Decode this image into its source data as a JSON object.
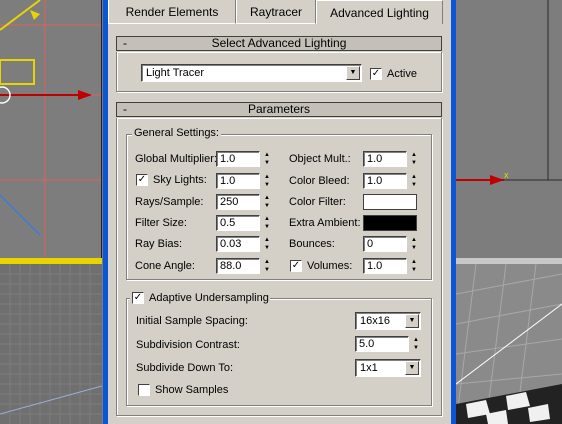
{
  "tabs": [
    {
      "label": "Render Elements"
    },
    {
      "label": "Raytracer"
    },
    {
      "label": "Advanced Lighting"
    }
  ],
  "select_rollout": {
    "title": "Select Advanced Lighting",
    "toggle": "-",
    "plugin": "Light Tracer",
    "active_label": "Active",
    "active_checked": true
  },
  "params_rollout": {
    "title": "Parameters",
    "toggle": "-"
  },
  "general": {
    "title": "General Settings:",
    "global_multiplier": {
      "label": "Global Multiplier:",
      "value": "1.0"
    },
    "sky_lights": {
      "label": "Sky Lights:",
      "value": "1.0",
      "checked": true
    },
    "rays_sample": {
      "label": "Rays/Sample:",
      "value": "250"
    },
    "filter_size": {
      "label": "Filter Size:",
      "value": "0.5"
    },
    "ray_bias": {
      "label": "Ray Bias:",
      "value": "0.03"
    },
    "cone_angle": {
      "label": "Cone Angle:",
      "value": "88.0"
    },
    "object_mult": {
      "label": "Object Mult.:",
      "value": "1.0"
    },
    "color_bleed": {
      "label": "Color Bleed:",
      "value": "1.0"
    },
    "color_filter": {
      "label": "Color Filter:",
      "color": "#ffffff"
    },
    "extra_ambient": {
      "label": "Extra Ambient:",
      "color": "#000000"
    },
    "bounces": {
      "label": "Bounces:",
      "value": "0"
    },
    "volumes": {
      "label": "Volumes:",
      "value": "1.0",
      "checked": true
    }
  },
  "adaptive": {
    "label": "Adaptive Undersampling",
    "checked": true,
    "initial_spacing": {
      "label": "Initial Sample Spacing:",
      "value": "16x16"
    },
    "subdiv_contrast": {
      "label": "Subdivision Contrast:",
      "value": "5.0"
    },
    "subdivide_down": {
      "label": "Subdivide Down To:",
      "value": "1x1"
    },
    "show_samples": {
      "label": "Show Samples",
      "checked": false
    }
  },
  "icons": {
    "spinner_up": "▲",
    "spinner_down": "▼",
    "dropdown": "▼",
    "check": "✓"
  },
  "colors": {
    "dialog_frame": "#0a56d6",
    "panel": "#d4d0c8",
    "viewport_active_border": "#e8d400"
  }
}
